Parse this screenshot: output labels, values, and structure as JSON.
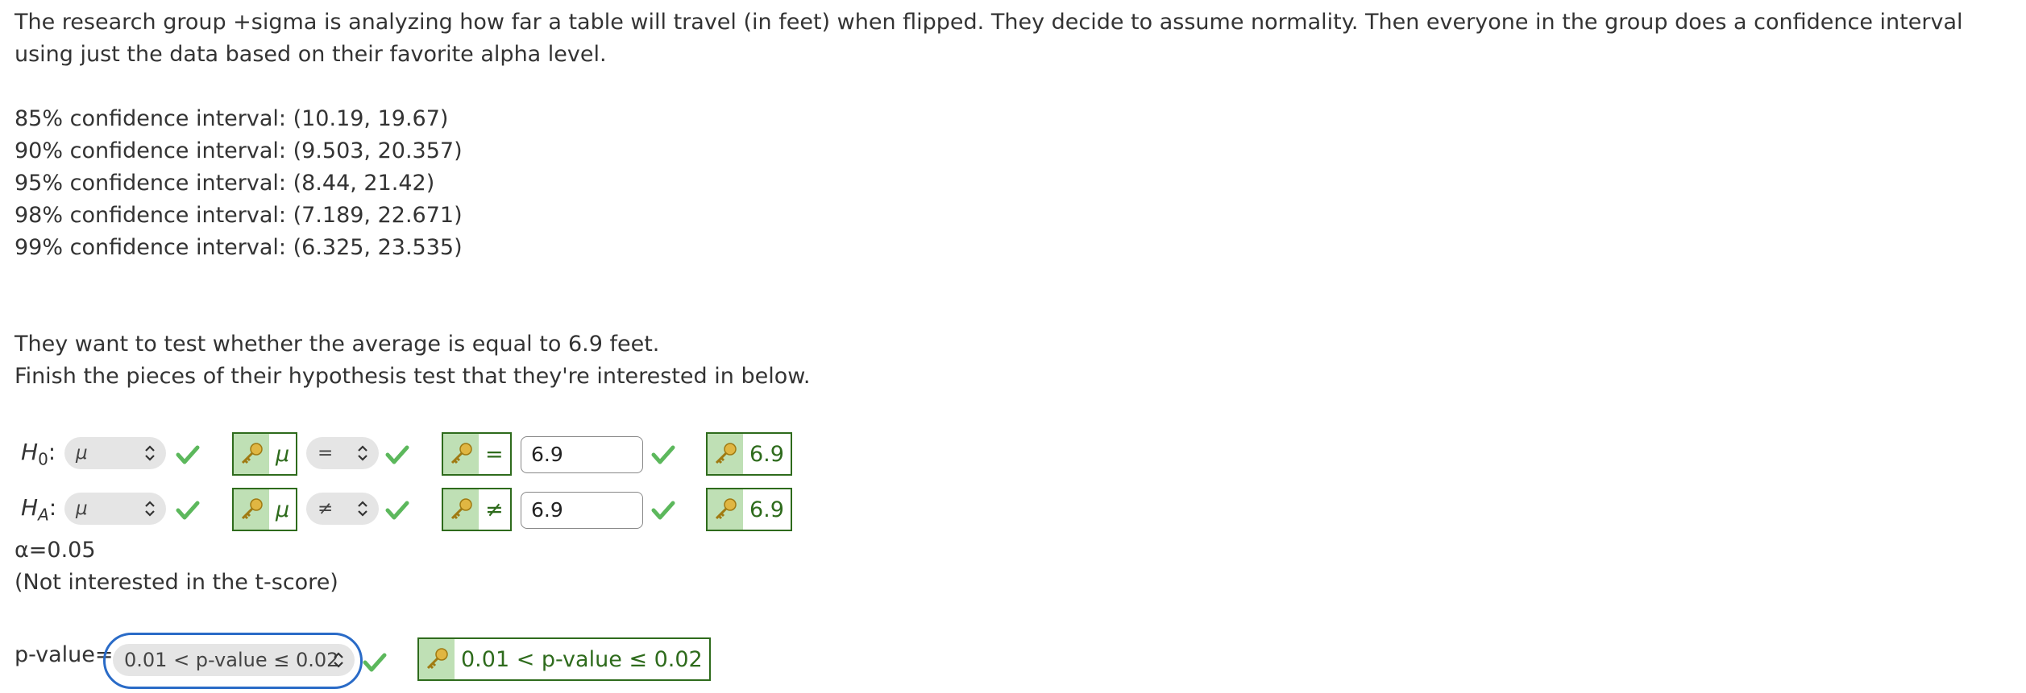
{
  "intro_text": "The research group +sigma is analyzing how far a table will travel (in feet) when flipped. They decide to assume normality. Then everyone in the group does a confidence interval using just the data based on their favorite alpha level.",
  "confidence_intervals": [
    "85% confidence interval: (10.19, 19.67)",
    "90% confidence interval: (9.503, 20.357)",
    "95% confidence interval: (8.44, 21.42)",
    "98% confidence interval: (7.189, 22.671)",
    "99% confidence interval: (6.325, 23.535)"
  ],
  "question_line1": "They want to test whether the average is equal to 6.9 feet.",
  "question_line2": "Finish the pieces of their hypothesis test that they're interested in below.",
  "h0": {
    "label_main": "H",
    "label_sub": "0",
    "colon": ":",
    "param_select": "μ",
    "param_key": "μ",
    "op_select": "=",
    "op_key": "=",
    "value_input": "6.9",
    "value_key": "6.9"
  },
  "ha": {
    "label_main": "H",
    "label_sub": "A",
    "colon": ":",
    "param_select": "μ",
    "param_key": "μ",
    "op_select": "≠",
    "op_key": "≠",
    "value_input": "6.9",
    "value_key": "6.9"
  },
  "alpha_text": "α=0.05",
  "not_interested_text": "(Not interested in the t-score)",
  "pvalue": {
    "label": "p-value=",
    "select": "0.01 < p-value ≤ 0.02",
    "key": "0.01 < p-value ≤ 0.02"
  },
  "icons": {
    "check": "check-icon",
    "key": "key-icon",
    "updown": "updown-chevron-icon"
  },
  "colors": {
    "correct_green": "#2e6b1c",
    "check_green": "#5cb85c",
    "key_bg": "#bfe0b5",
    "focus_blue": "#2a6bc7",
    "select_bg": "#e5e5e5"
  }
}
